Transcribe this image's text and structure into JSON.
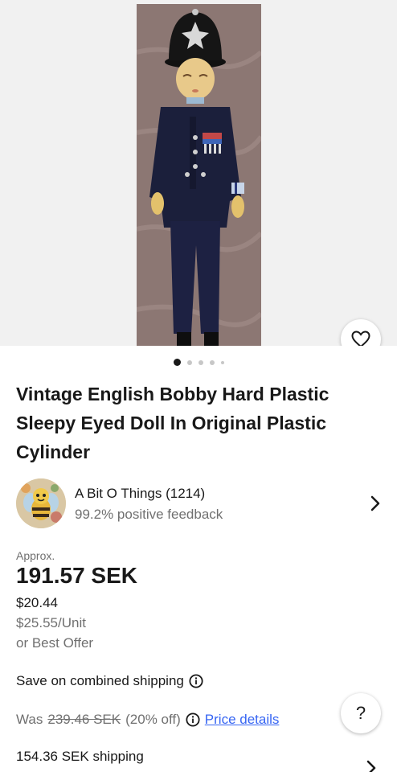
{
  "gallery": {
    "dots_count": 5,
    "active_index": 0
  },
  "listing": {
    "title": "Vintage English Bobby Hard Plastic Sleepy Eyed Doll In Original Plastic Cylinder"
  },
  "seller": {
    "name": "A Bit O Things (1214)",
    "feedback": "99.2% positive feedback"
  },
  "pricing": {
    "approx_label": "Approx.",
    "price": "191.57 SEK",
    "usd": "$20.44",
    "per_unit": "$25.55/Unit",
    "best_offer": "or Best Offer",
    "combined_shipping": "Save on combined shipping",
    "was_label": "Was",
    "was_price": "239.46 SEK",
    "discount": "(20% off)",
    "price_details": "Price details",
    "shipping": "154.36 SEK shipping"
  },
  "help": {
    "symbol": "?"
  },
  "colors": {
    "link": "#3665f3",
    "secondary_text": "#707070",
    "primary_text": "#191919"
  }
}
